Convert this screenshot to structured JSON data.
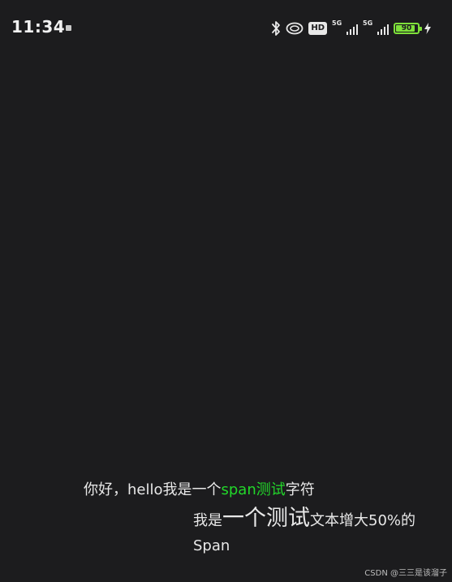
{
  "status_bar": {
    "time": "11:34",
    "hd_label": "HD",
    "net1": "5G",
    "net2": "5G",
    "battery_level": "90",
    "battery_percent": 90,
    "battery_color": "#7ee03a"
  },
  "content": {
    "line1_prefix": "你好，hello我是一个",
    "line1_green": "span测试",
    "line1_suffix": "字符",
    "line2_prefix": "我是",
    "line2_big": "一个测试",
    "line2_suffix": "文本增大50%的",
    "line2_word": "Span",
    "green_color": "#22d82a"
  },
  "watermark": "CSDN @三三是该溜子"
}
